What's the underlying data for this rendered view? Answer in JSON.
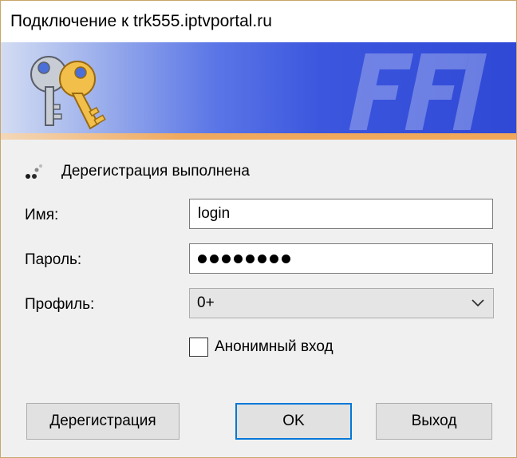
{
  "window": {
    "title": "Подключение к trk555.iptvportal.ru"
  },
  "banner": {
    "icon": "keys-icon",
    "gradient_colors": [
      "#d3dcf3",
      "#5a75e6",
      "#2f49d6"
    ],
    "accent_stripe": "#efa95e"
  },
  "status": {
    "icon": "connection-status-icon",
    "text": "Дерегистрация выполнена"
  },
  "form": {
    "name_label": "Имя:",
    "name_value": "login",
    "password_label": "Пароль:",
    "password_mask_length": 8,
    "profile_label": "Профиль:",
    "profile_value": "0+",
    "anonymous_label": "Анонимный вход",
    "anonymous_checked": false
  },
  "buttons": {
    "deregister": "Дерегистрация",
    "ok": "OK",
    "exit": "Выход"
  },
  "colors": {
    "focus_border": "#0078d7",
    "button_bg": "#e1e1e1",
    "dialog_bg": "#f0f0f0"
  }
}
